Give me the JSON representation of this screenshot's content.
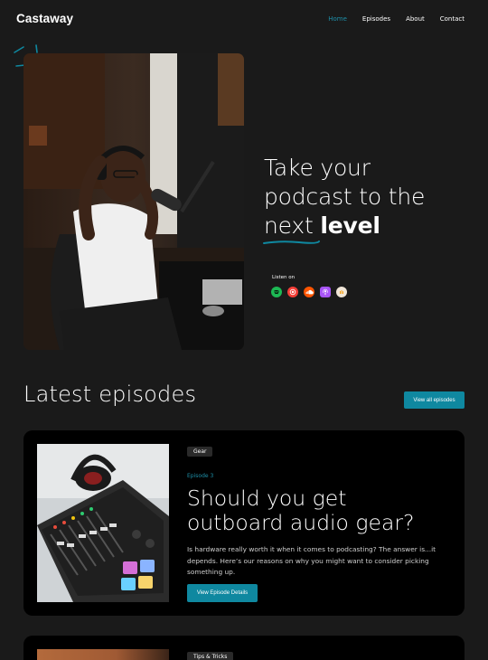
{
  "brand": {
    "logo": "Castaway"
  },
  "nav": {
    "items": [
      {
        "label": "Home",
        "active": true
      },
      {
        "label": "Episodes",
        "active": false
      },
      {
        "label": "About",
        "active": false
      },
      {
        "label": "Contact",
        "active": false
      }
    ]
  },
  "hero": {
    "title_line1": "Take your",
    "title_line2": "podcast to the",
    "title_word_underlined": "next",
    "title_word_bold": "level",
    "listen_label": "Listen on",
    "platforms": [
      {
        "name": "spotify-icon",
        "color": "#1db954"
      },
      {
        "name": "pocket-casts-icon",
        "color": "#f43e37"
      },
      {
        "name": "soundcloud-icon",
        "color": "#ff5500"
      },
      {
        "name": "apple-podcasts-icon",
        "color": "#a855f7"
      },
      {
        "name": "castbox-icon",
        "color": "#f5a623"
      }
    ]
  },
  "latest": {
    "title": "Latest episodes",
    "view_all_label": "View all episodes"
  },
  "episodes": [
    {
      "tag": "Gear",
      "number": "Episode 3",
      "title": "Should you get outboard audio gear?",
      "description": "Is hardware really worth it when it comes to podcasting? The answer is...it depends. Here’s our reasons on why you might want to consider picking something up.",
      "button_label": "View Episode Details"
    },
    {
      "tag": "Tips & Tricks"
    }
  ],
  "colors": {
    "accent": "#0f88a0",
    "background": "#1a1a1a",
    "card": "#000000"
  }
}
